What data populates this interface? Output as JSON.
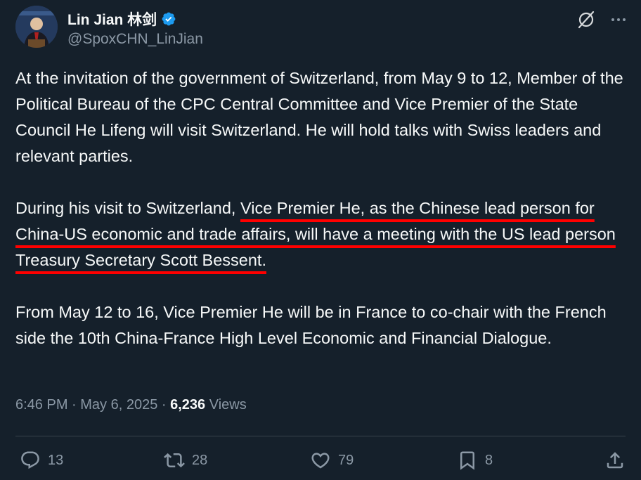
{
  "author": {
    "display_name": "Lin Jian 林剑",
    "handle": "@SpoxCHN_LinJian",
    "verified": true
  },
  "post": {
    "paragraphs": [
      {
        "segments": [
          {
            "text": "At the invitation of the government of Switzerland, from May 9 to 12, Member of the Political Bureau of the CPC Central Committee and Vice Premier of the State Council He Lifeng will visit Switzerland. He will hold talks with Swiss leaders and relevant parties.",
            "highlight": false
          }
        ]
      },
      {
        "segments": [
          {
            "text": "During his visit to Switzerland, ",
            "highlight": false
          },
          {
            "text": "Vice Premier He, as the Chinese lead person for China-US economic and trade affairs, will have a meeting with the US lead person Treasury Secretary Scott Bessent.",
            "highlight": true
          }
        ]
      },
      {
        "segments": [
          {
            "text": "From May 12 to 16, Vice Premier He will be in France to co-chair with the French side the 10th China-France High Level Economic and Financial Dialogue.",
            "highlight": false
          }
        ]
      }
    ],
    "highlight_color": "#ff0000"
  },
  "meta": {
    "time": "6:46 PM",
    "separator": " · ",
    "date": "May 6, 2025",
    "views_count": "6,236",
    "views_label": "Views"
  },
  "actions": {
    "replies": "13",
    "reposts": "28",
    "likes": "79",
    "bookmarks": "8"
  },
  "icons": {
    "verified": "verified-badge-icon",
    "grok": "grok-icon",
    "more": "more-icon",
    "reply": "reply-icon",
    "repost": "repost-icon",
    "like": "like-icon",
    "bookmark": "bookmark-icon",
    "share": "share-icon"
  },
  "colors": {
    "background": "#15202b",
    "text": "#f7f9f9",
    "secondary": "#8b98a5",
    "verified": "#1d9bf0"
  }
}
